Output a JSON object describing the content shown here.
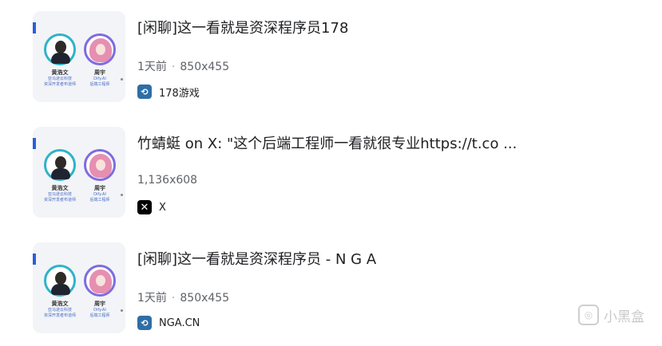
{
  "results": [
    {
      "title": "[闲聊]这一看就是资深程序员178",
      "time": "1天前",
      "size": "850x455",
      "source": "178游戏",
      "favicon": "178-logo-icon",
      "thumb": {
        "person1": "黄浩文",
        "person1_sub1": "亚马逊云科技",
        "person1_sub2": "资深开发者布道师",
        "person2": "周宇",
        "person2_sub1": "Dify.AI",
        "person2_sub2": "后端工程师"
      }
    },
    {
      "title": "竹蜻蜓 on X: \"这个后端工程师一看就很专业https://t.co ...",
      "size": "1,136x608",
      "source": "X",
      "favicon": "x-logo-icon",
      "thumb": {
        "person1": "黄浩文",
        "person1_sub1": "亚马逊云科技",
        "person1_sub2": "资深开发者布道师",
        "person2": "周宇",
        "person2_sub1": "Dify.AI",
        "person2_sub2": "后端工程师"
      }
    },
    {
      "title": "[闲聊]这一看就是资深程序员 - N G A",
      "time": "1天前",
      "size": "850x455",
      "source": "NGA.CN",
      "favicon": "nga-logo-icon",
      "thumb": {
        "person1": "黄浩文",
        "person1_sub1": "亚马逊云科技",
        "person1_sub2": "资深开发者布道师",
        "person2": "周宇",
        "person2_sub1": "Dify.AI",
        "person2_sub2": "后端工程师"
      }
    }
  ],
  "watermark": {
    "text": "小黑盒",
    "icon": "heybox-logo-icon"
  }
}
